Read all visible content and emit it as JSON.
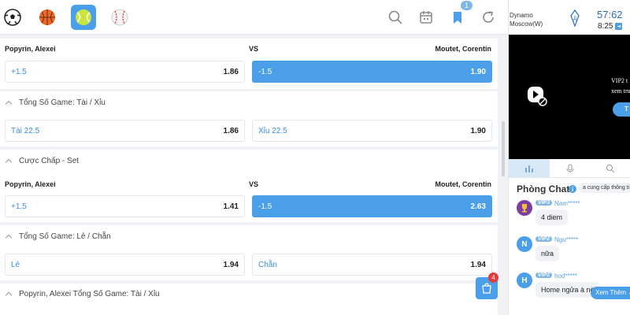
{
  "sports": [
    {
      "icon": "soccer-ball-icon"
    },
    {
      "icon": "basketball-icon"
    },
    {
      "icon": "tennis-ball-icon",
      "active": true
    },
    {
      "icon": "baseball-icon"
    }
  ],
  "toolbar": {
    "badge_count": "1"
  },
  "markets": {
    "m1": {
      "home": "Popyrin, Alexei",
      "vs": "VS",
      "away": "Moutet, Corentin",
      "left": {
        "label": "+1.5",
        "odd": "1.86"
      },
      "right": {
        "label": "-1.5",
        "odd": "1.90"
      }
    },
    "s2": {
      "title": "Tổng Số Game: Tài / Xỉu",
      "left": {
        "label": "Tài  22.5",
        "odd": "1.86"
      },
      "right": {
        "label": "Xỉu  22.5",
        "odd": "1.90"
      }
    },
    "s3": {
      "title": "Cược Chấp - Set",
      "home": "Popyrin, Alexei",
      "vs": "VS",
      "away": "Moutet, Corentin",
      "left": {
        "label": "+1.5",
        "odd": "1.41"
      },
      "right": {
        "label": "-1.5",
        "odd": "2.63"
      }
    },
    "s4": {
      "title": "Tổng Số Game: Lẻ / Chẵn",
      "left": {
        "label": "Lẻ",
        "odd": "1.94"
      },
      "right": {
        "label": "Chẵn",
        "odd": "1.94"
      }
    },
    "s5": {
      "title": "Popyrin, Alexei Tổng Số Game: Tài / Xỉu"
    }
  },
  "cart": {
    "count": "4"
  },
  "scoreboard": {
    "team": "Dynamo Moscow(W)",
    "clock": "57:62",
    "sub_time": "8:25"
  },
  "video": {
    "line1": "VIP2 t",
    "line2": "xem trư",
    "button": "T"
  },
  "chat": {
    "title": "Phòng Chat",
    "notice": "a cung cấp thông ti",
    "messages": [
      {
        "initial": "",
        "vip": "VIP3",
        "user": "Nam*****",
        "text": "4 diem"
      },
      {
        "initial": "N",
        "vip": "VIP2",
        "user": "Ngu*****",
        "text": "nữa"
      },
      {
        "initial": "H",
        "vip": "VIP2",
        "user": "hod*****",
        "text": "Home ngửa à nè"
      }
    ],
    "more_button": "Xem Thêm"
  },
  "colors": {
    "accent": "#4a9fe8",
    "background": "#f0f2f5"
  }
}
